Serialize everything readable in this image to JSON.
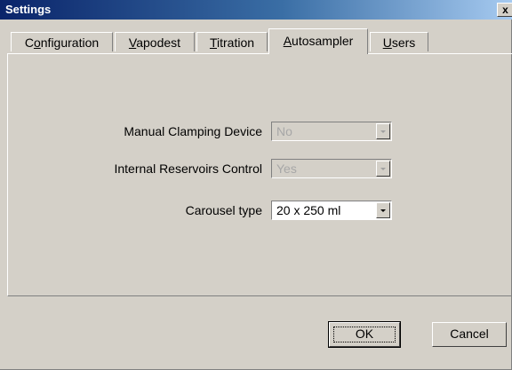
{
  "window": {
    "title": "Settings",
    "close_glyph": "x"
  },
  "tabs": [
    {
      "pre": "C",
      "ul": "o",
      "post": "nfiguration",
      "active": false
    },
    {
      "pre": "",
      "ul": "V",
      "post": "apodest",
      "active": false
    },
    {
      "pre": "",
      "ul": "T",
      "post": "itration",
      "active": false
    },
    {
      "pre": "",
      "ul": "A",
      "post": "utosampler",
      "active": true
    },
    {
      "pre": "",
      "ul": "U",
      "post": "sers",
      "active": false
    }
  ],
  "fields": {
    "manual_clamping": {
      "label": "Manual Clamping Device",
      "value": "No",
      "enabled": false
    },
    "reservoirs": {
      "label": "Internal Reservoirs Control",
      "value": "Yes",
      "enabled": false
    },
    "carousel": {
      "label": "Carousel type",
      "value": "20 x 250 ml",
      "enabled": true
    }
  },
  "buttons": {
    "ok": "OK",
    "cancel": "Cancel"
  }
}
